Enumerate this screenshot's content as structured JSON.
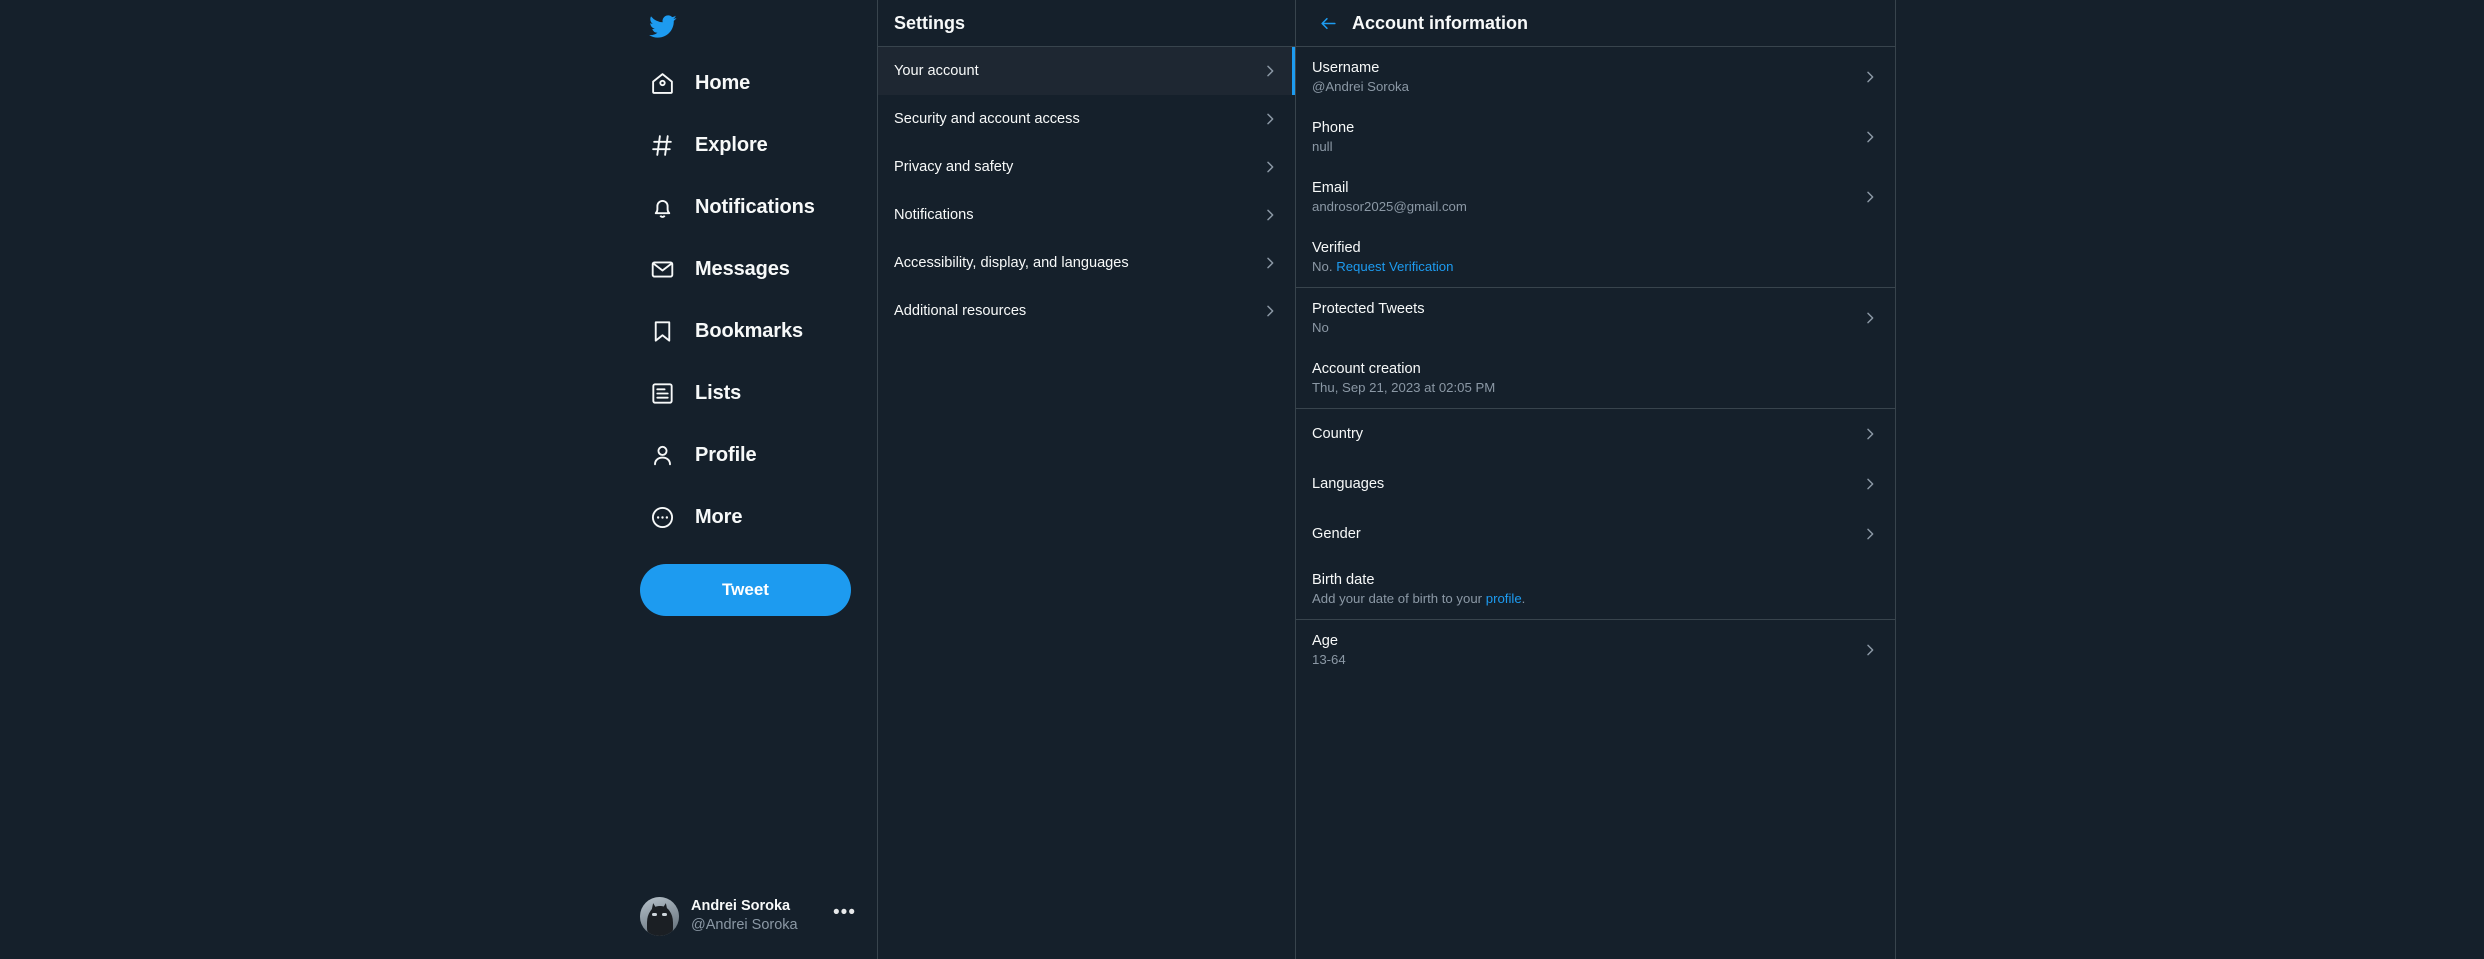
{
  "theme": {
    "background": "#15202B",
    "accent": "#1D9BF0",
    "text_primary": "#F7F9F9",
    "text_secondary": "#8B98A5",
    "border": "#38444D",
    "selected_row_bg": "#1E2732"
  },
  "nav": {
    "logo_icon": "twitter-bird-icon",
    "items": [
      {
        "label": "Home",
        "icon": "home-icon"
      },
      {
        "label": "Explore",
        "icon": "hashtag-icon"
      },
      {
        "label": "Notifications",
        "icon": "bell-icon"
      },
      {
        "label": "Messages",
        "icon": "envelope-icon"
      },
      {
        "label": "Bookmarks",
        "icon": "bookmark-icon"
      },
      {
        "label": "Lists",
        "icon": "list-icon"
      },
      {
        "label": "Profile",
        "icon": "person-icon"
      },
      {
        "label": "More",
        "icon": "more-circle-icon"
      }
    ],
    "tweet_button": "Tweet",
    "account": {
      "name": "Andrei Soroka",
      "handle": "@Andrei Soroka",
      "more_icon": "ellipsis-icon",
      "avatar_icon": "user-avatar"
    }
  },
  "settings": {
    "title": "Settings",
    "items": [
      {
        "label": "Your account",
        "selected": true
      },
      {
        "label": "Security and account access",
        "selected": false
      },
      {
        "label": "Privacy and safety",
        "selected": false
      },
      {
        "label": "Notifications",
        "selected": false
      },
      {
        "label": "Accessibility, display, and languages",
        "selected": false
      },
      {
        "label": "Additional resources",
        "selected": false
      }
    ]
  },
  "detail": {
    "title": "Account information",
    "back_icon": "arrow-left-icon",
    "groups": [
      {
        "rows": [
          {
            "label": "Username",
            "value": "@Andrei Soroka",
            "chevron": true
          },
          {
            "label": "Phone",
            "value": "null",
            "chevron": true
          },
          {
            "label": "Email",
            "value": "androsor2025@gmail.com",
            "chevron": true
          },
          {
            "label": "Verified",
            "value_prefix": "No. ",
            "value_link": "Request Verification",
            "chevron": false
          }
        ]
      },
      {
        "rows": [
          {
            "label": "Protected Tweets",
            "value": "No",
            "chevron": true
          },
          {
            "label": "Account creation",
            "value": "Thu, Sep 21, 2023 at 02:05 PM",
            "chevron": false
          }
        ]
      },
      {
        "rows": [
          {
            "label": "Country",
            "value": "",
            "chevron": true
          },
          {
            "label": "Languages",
            "value": "",
            "chevron": true
          },
          {
            "label": "Gender",
            "value": "",
            "chevron": true
          },
          {
            "label": "Birth date",
            "value_prefix": "Add your date of birth to your ",
            "value_link": "profile",
            "value_suffix": ".",
            "chevron": false
          }
        ]
      },
      {
        "rows": [
          {
            "label": "Age",
            "value": "13-64",
            "chevron": true
          }
        ]
      }
    ]
  }
}
